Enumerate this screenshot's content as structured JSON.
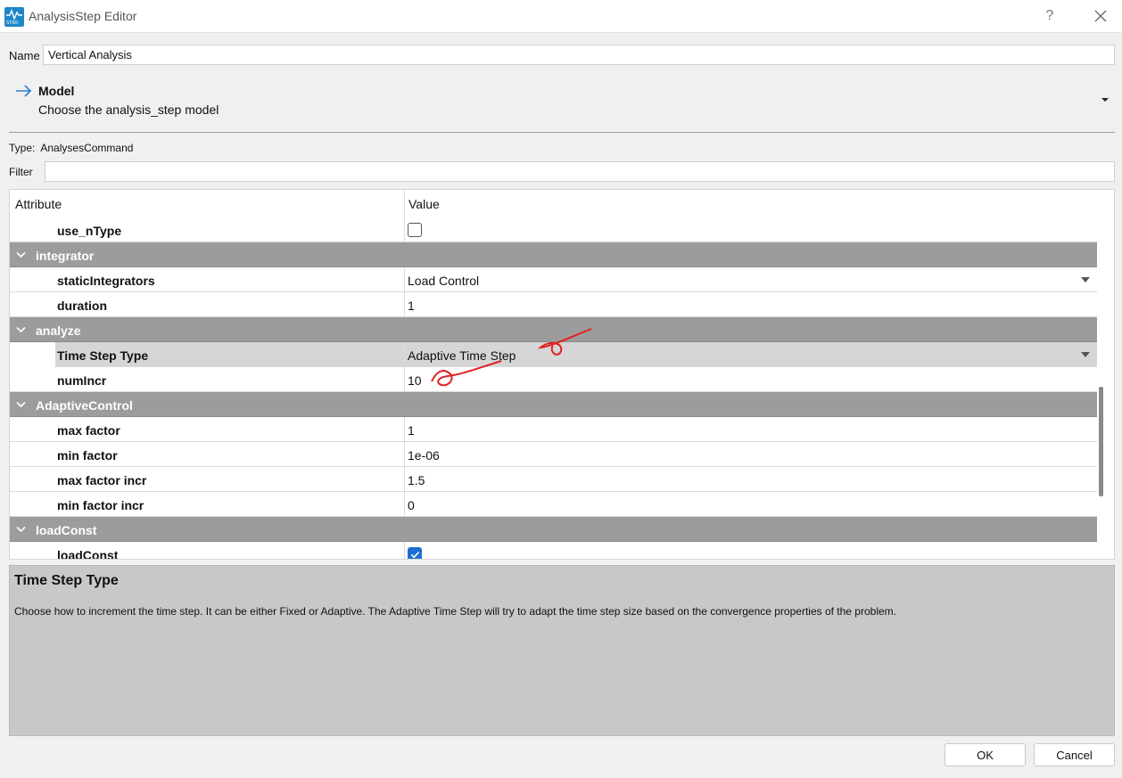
{
  "window": {
    "title": "AnalysisStep Editor",
    "help_glyph": "?",
    "icon_label": "STKO"
  },
  "name_field": {
    "label": "Name",
    "value": "Vertical Analysis"
  },
  "model": {
    "title": "Model",
    "subtitle": "Choose the analysis_step model"
  },
  "type": {
    "label": "Type:",
    "value": "AnalysesCommand"
  },
  "filter": {
    "label": "Filter",
    "value": ""
  },
  "grid": {
    "header": {
      "attribute": "Attribute",
      "value": "Value"
    },
    "rows": [
      {
        "kind": "item",
        "attr": "use_nType",
        "widget": "checkbox",
        "checked": false
      },
      {
        "kind": "group",
        "attr": "integrator"
      },
      {
        "kind": "item",
        "attr": "staticIntegrators",
        "value": "Load Control",
        "widget": "combo"
      },
      {
        "kind": "item",
        "attr": "duration",
        "value": "1"
      },
      {
        "kind": "group",
        "attr": "analyze"
      },
      {
        "kind": "item",
        "attr": "Time Step Type",
        "value": "Adaptive Time Step",
        "widget": "combo",
        "selected": true
      },
      {
        "kind": "item",
        "attr": "numIncr",
        "value": "10"
      },
      {
        "kind": "group",
        "attr": "AdaptiveControl"
      },
      {
        "kind": "item",
        "attr": "max factor",
        "value": "1"
      },
      {
        "kind": "item",
        "attr": "min factor",
        "value": "1e-06"
      },
      {
        "kind": "item",
        "attr": "max factor incr",
        "value": "1.5"
      },
      {
        "kind": "item",
        "attr": "min factor incr",
        "value": "0"
      },
      {
        "kind": "group",
        "attr": "loadConst"
      },
      {
        "kind": "item",
        "attr": "loadConst",
        "widget": "checkbox",
        "checked": true
      }
    ]
  },
  "description": {
    "title": "Time Step Type",
    "text": "Choose how to increment the time step. It can be either Fixed or Adaptive. The Adaptive Time Step will try to adapt the time step size based on the convergence properties of the problem."
  },
  "buttons": {
    "ok": "OK",
    "cancel": "Cancel"
  },
  "colors": {
    "accent": "#1f6fd0",
    "group_header": "#9c9c9c",
    "annotation": "#e02020"
  }
}
